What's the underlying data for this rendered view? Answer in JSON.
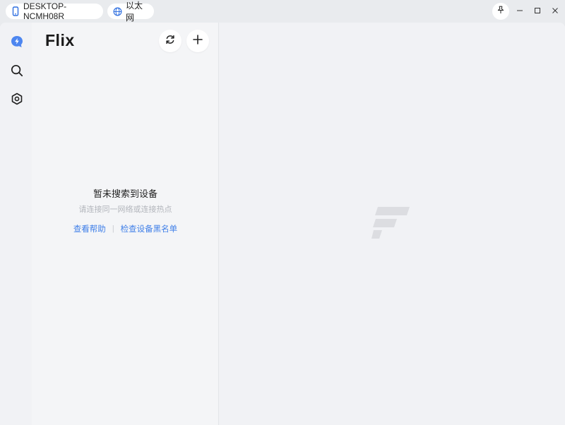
{
  "titlebar": {
    "device_name": "DESKTOP-NCMH08R",
    "network_name": "以太网",
    "icons": {
      "device": "phone-icon",
      "network": "globe-icon",
      "pin": "pin-icon",
      "minimize": "minimize-icon",
      "maximize": "maximize-icon",
      "close": "close-icon"
    }
  },
  "sidebar": {
    "items": [
      {
        "name": "devices",
        "icon": "lightning-bolt-icon",
        "active": true
      },
      {
        "name": "search",
        "icon": "search-icon",
        "active": false
      },
      {
        "name": "settings",
        "icon": "settings-icon",
        "active": false
      }
    ]
  },
  "panel": {
    "brand": "Flix",
    "refresh_icon": "refresh-icon",
    "add_icon": "plus-icon",
    "empty_state": {
      "title": "暂未搜索到设备",
      "subtitle": "请连接同一网络或连接热点",
      "help_link": "查看帮助",
      "separator": "|",
      "blacklist_link": "检查设备黑名单"
    }
  },
  "main": {
    "watermark_icon": "flix-logo-icon"
  },
  "colors": {
    "accent": "#3f7fe8",
    "background": "#f1f2f5",
    "panel": "#f4f5f7",
    "titlebar": "#e9ebee"
  }
}
